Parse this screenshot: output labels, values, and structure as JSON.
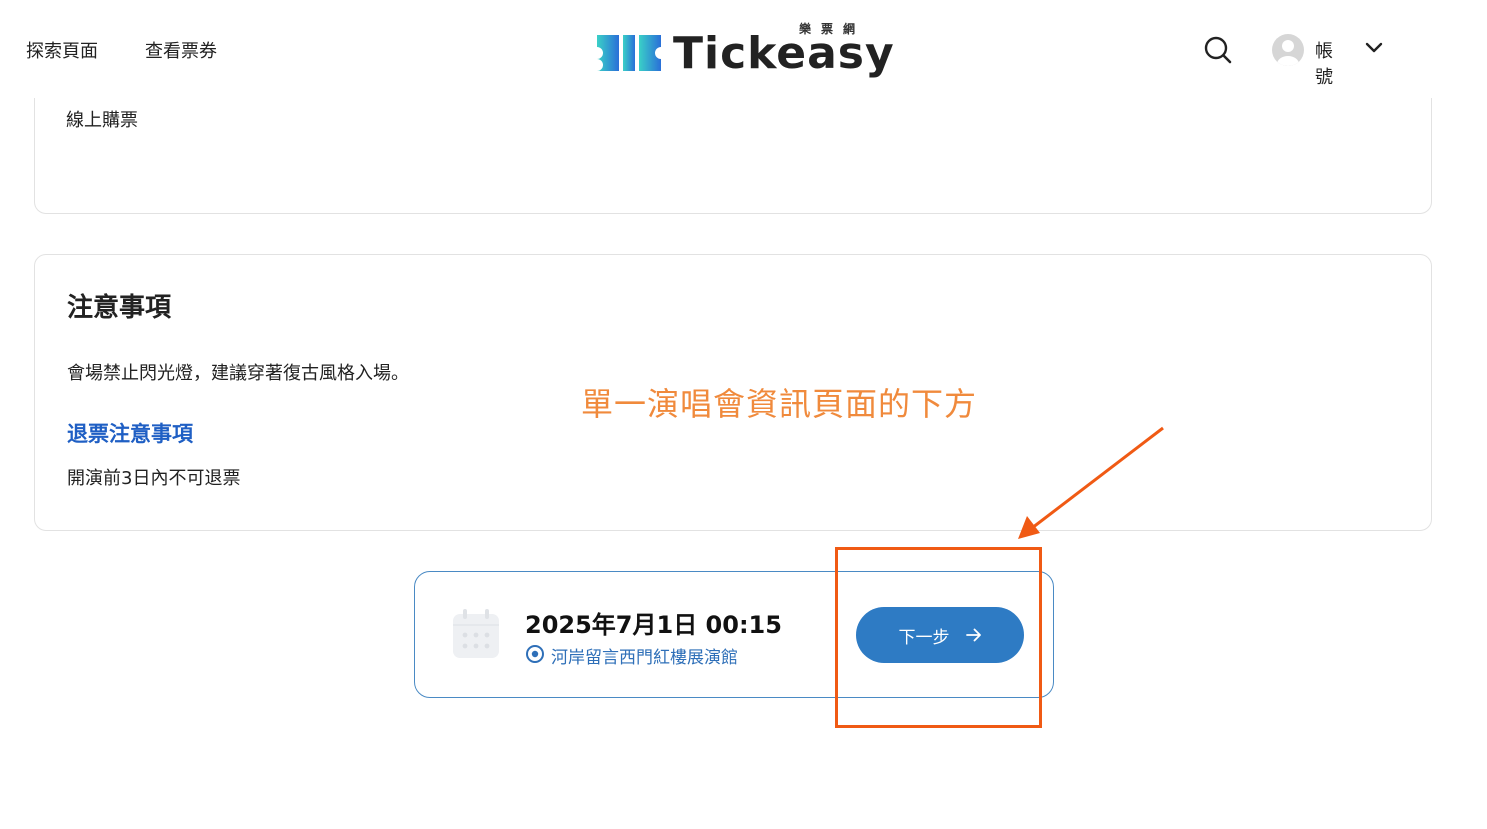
{
  "header": {
    "nav": {
      "explore": "探索頁面",
      "tickets": "查看票券"
    },
    "logo": {
      "word": "Tickeasy",
      "sub": "樂票網"
    },
    "account_label": "帳號"
  },
  "purchase_card": {
    "text": "線上購票"
  },
  "notes": {
    "title": "注意事項",
    "body": "會場禁止閃光燈，建議穿著復古風格入場。",
    "refund_title": "退票注意事項",
    "refund_body": "開演前3日內不可退票"
  },
  "booking": {
    "date": "2025年7月1日 00:15",
    "venue": "河岸留言西門紅樓展演館",
    "next_label": "下一步"
  },
  "annotation": {
    "text": "單一演唱會資訊頁面的下方"
  },
  "colors": {
    "brand_blue": "#2e7bc4",
    "link_blue": "#1f5fc4",
    "annotation_orange": "#f05a14"
  }
}
